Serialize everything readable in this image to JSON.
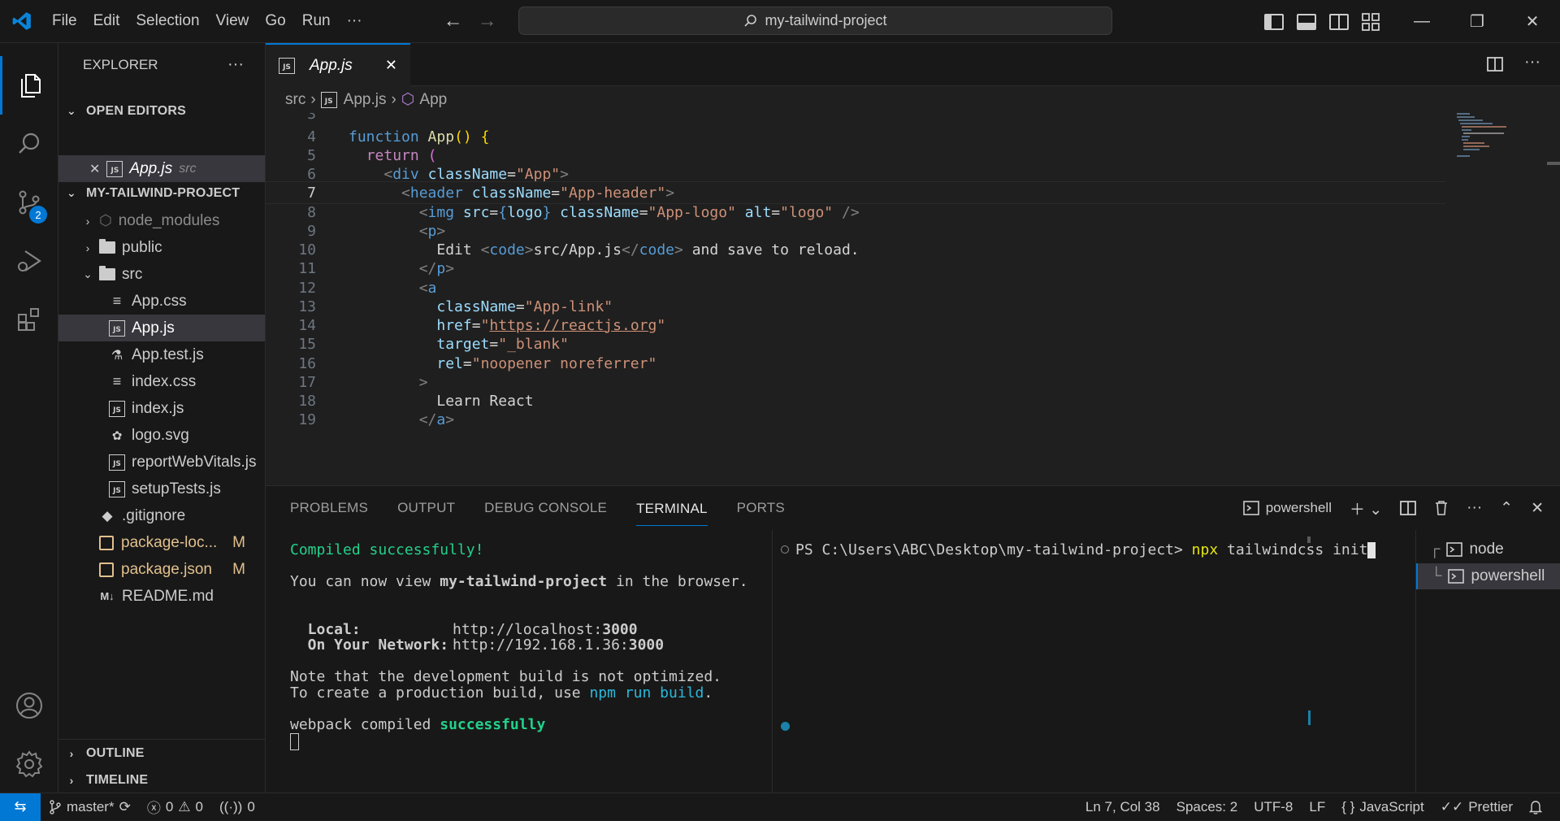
{
  "titlebar": {
    "menu": [
      "File",
      "Edit",
      "Selection",
      "View",
      "Go",
      "Run"
    ],
    "more": "···",
    "search_text": "my-tailwind-project"
  },
  "activity": {
    "source_control_badge": "2"
  },
  "sidebar": {
    "title": "EXPLORER",
    "more": "···",
    "open_editors": {
      "header": "OPEN EDITORS",
      "items": [
        {
          "name": "App.js",
          "path": "src"
        }
      ]
    },
    "project": {
      "header": "MY-TAILWIND-PROJECT",
      "tree": [
        {
          "label": "node_modules",
          "kind": "folder-collapsed"
        },
        {
          "label": "public",
          "kind": "folder-collapsed"
        },
        {
          "label": "src",
          "kind": "folder-open"
        },
        {
          "label": "App.css",
          "kind": "css"
        },
        {
          "label": "App.js",
          "kind": "js"
        },
        {
          "label": "App.test.js",
          "kind": "test"
        },
        {
          "label": "index.css",
          "kind": "css"
        },
        {
          "label": "index.js",
          "kind": "js"
        },
        {
          "label": "logo.svg",
          "kind": "svg"
        },
        {
          "label": "reportWebVitals.js",
          "kind": "js"
        },
        {
          "label": "setupTests.js",
          "kind": "js"
        },
        {
          "label": ".gitignore",
          "kind": "git"
        },
        {
          "label": "package-loc...",
          "kind": "json",
          "status": "M"
        },
        {
          "label": "package.json",
          "kind": "json",
          "status": "M"
        },
        {
          "label": "README.md",
          "kind": "md"
        }
      ]
    },
    "outline": "OUTLINE",
    "timeline": "TIMELINE"
  },
  "editor": {
    "tab_label": "App.js",
    "breadcrumb": [
      "src",
      "App.js",
      "App"
    ],
    "current_line": "7"
  },
  "panel": {
    "tabs": [
      "PROBLEMS",
      "OUTPUT",
      "DEBUG CONSOLE",
      "TERMINAL",
      "PORTS"
    ],
    "shell_label": "powershell",
    "term_left": {
      "compiled": "Compiled successfully!",
      "view_prefix": "You can now view ",
      "project": "my-tailwind-project",
      "view_suffix": " in the browser.",
      "local_label": "  Local:",
      "local_url_pre": "http://localhost:",
      "local_port": "3000",
      "net_label": "  On Your Network:",
      "net_url_pre": "http://192.168.1.36:",
      "net_port": "3000",
      "note1": "Note that the development build is not optimized.",
      "note2_pre": "To create a production build, use ",
      "note2_cmd": "npm run build",
      "note2_post": ".",
      "webpack_pre": "webpack compiled ",
      "webpack_status": "successfully"
    },
    "term_right": {
      "prompt": "PS C:\\Users\\ABC\\Desktop\\my-tailwind-project> ",
      "cmd": "npx",
      "args": " tailwindcss init"
    },
    "terminals": [
      "node",
      "powershell"
    ]
  },
  "statusbar": {
    "branch": "master*",
    "errors": "0",
    "warnings": "0",
    "ports": "0",
    "position": "Ln 7, Col 38",
    "spaces": "Spaces: 2",
    "encoding": "UTF-8",
    "eol": "LF",
    "language": "JavaScript",
    "formatter": "Prettier"
  }
}
